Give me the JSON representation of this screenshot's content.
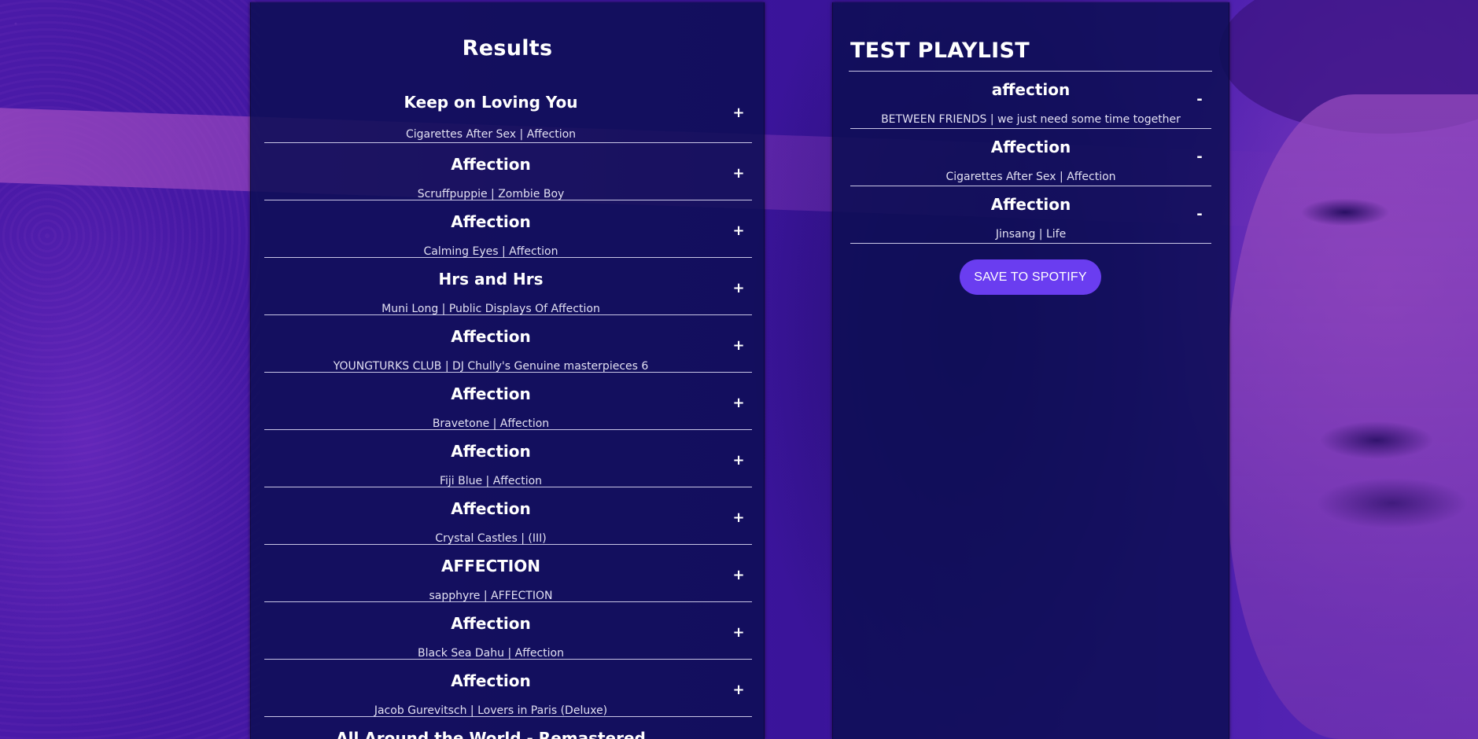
{
  "results": {
    "title": "Results",
    "add_symbol": "+",
    "tracks": [
      {
        "name": "Keep on Loving You",
        "info": "Cigarettes After Sex | Affection"
      },
      {
        "name": "Affection",
        "info": "Scruffpuppie | Zombie Boy"
      },
      {
        "name": "Affection",
        "info": "Calming Eyes | Affection"
      },
      {
        "name": "Hrs and Hrs",
        "info": "Muni Long | Public Displays Of Affection"
      },
      {
        "name": "Affection",
        "info": "YOUNGTURKS CLUB | DJ Chully's Genuine masterpieces 6"
      },
      {
        "name": "Affection",
        "info": "Bravetone | Affection"
      },
      {
        "name": "Affection",
        "info": "Fiji Blue | Affection"
      },
      {
        "name": "Affection",
        "info": "Crystal Castles | (III)"
      },
      {
        "name": "AFFECTION",
        "info": "sapphyre | AFFECTION"
      },
      {
        "name": "Affection",
        "info": "Black Sea Dahu | Affection"
      },
      {
        "name": "Affection",
        "info": "Jacob Gurevitsch | Lovers in Paris (Deluxe)"
      },
      {
        "name": "All Around the World - Remastered",
        "info": ""
      }
    ]
  },
  "playlist": {
    "name": "TEST PLAYLIST",
    "remove_symbol": "-",
    "tracks": [
      {
        "name": "affection",
        "info": "BETWEEN FRIENDS | we just need some time together"
      },
      {
        "name": "Affection",
        "info": "Cigarettes After Sex | Affection"
      },
      {
        "name": "Affection",
        "info": "Jinsang | Life"
      }
    ],
    "save_label": "SAVE TO SPOTIFY"
  },
  "colors": {
    "panel": "#0d0e54",
    "accent_button": "#6a3df0",
    "background": "#3e1a9e"
  }
}
